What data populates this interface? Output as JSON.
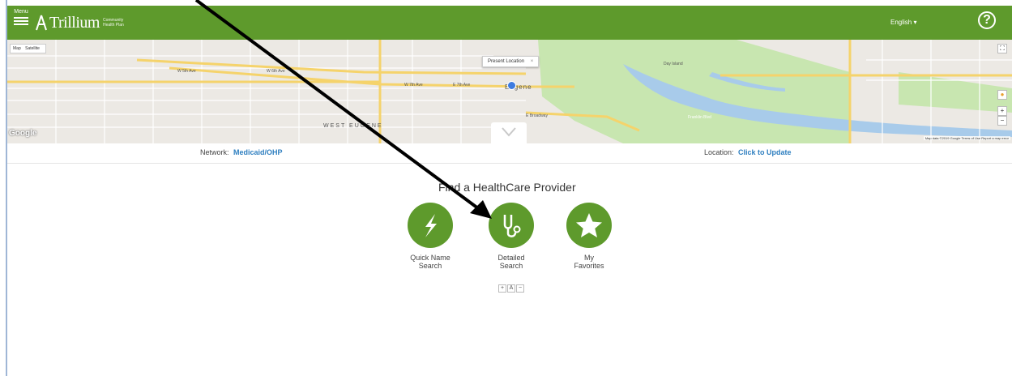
{
  "header": {
    "menu_label": "Menu",
    "logo_name": "Trillium",
    "logo_tag_1": "Community",
    "logo_tag_2": "Health Plan",
    "language": "English ▾",
    "help": "?"
  },
  "map": {
    "tab_map": "Map",
    "tab_satellite": "Satellite",
    "present_location": "Present Location",
    "close": "×",
    "google": "Google",
    "footer": "Map data ©2019 Google   Terms of Use   Report a map error",
    "zoom_in": "+",
    "zoom_out": "−",
    "street_labels": [
      "W 5th Ave",
      "W 6th Ave",
      "W 7th Ave",
      "E 7th Ave",
      "E Broadway",
      "WEST EUGENE",
      "Eugene",
      "Day Island",
      "Franklin Blvd"
    ]
  },
  "network": {
    "label": "Network:",
    "value": "Medicaid/OHP"
  },
  "location": {
    "label": "Location:",
    "value": "Click to Update"
  },
  "find": {
    "title": "Find a HealthCare Provider",
    "options": [
      {
        "line1": "Quick Name",
        "line2": "Search"
      },
      {
        "line1": "Detailed",
        "line2": "Search"
      },
      {
        "line1": "My",
        "line2": "Favorites"
      }
    ]
  },
  "font_controls": [
    "+",
    "A",
    "−"
  ],
  "colors": {
    "brand_green": "#5e9a2c",
    "link_blue": "#2f7fc0"
  }
}
